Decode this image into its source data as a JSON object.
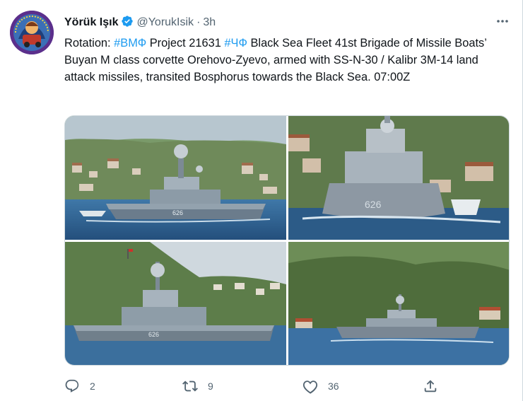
{
  "tweet": {
    "display_name": "Yörük Işık",
    "handle": "@YorukIsik",
    "separator": "·",
    "time": "3h",
    "text_parts": [
      {
        "text": "Rotation: ",
        "type": "text"
      },
      {
        "text": "#ВМФ",
        "type": "hashtag"
      },
      {
        "text": " Project 21631 ",
        "type": "text"
      },
      {
        "text": "#ЧФ",
        "type": "hashtag"
      },
      {
        "text": " Black Sea Fleet 41st Brigade of Missile Boats’ Buyan M class corvette Orehovo-Zyevo, armed with SS-N-30 / Kalibr 3M-14 land attack missiles, transited Bosphorus towards the Black Sea. 07:00Z",
        "type": "text"
      }
    ],
    "media": {
      "photos": [
        {
          "hull_number": "626",
          "scene": "corvette sailing left, side view"
        },
        {
          "hull_number": "626",
          "scene": "corvette bow-on with escort boat"
        },
        {
          "hull_number": "626",
          "scene": "corvette side view, hillside background"
        },
        {
          "hull_number": "",
          "scene": "corvette distant, wooded shore"
        }
      ]
    },
    "actions": {
      "reply_count": "2",
      "retweet_count": "9",
      "like_count": "36"
    },
    "icons": {
      "verified": "verified-badge-icon",
      "more": "more-icon",
      "reply": "reply-icon",
      "retweet": "retweet-icon",
      "like": "like-icon",
      "share": "share-icon"
    },
    "colors": {
      "accent": "#1d9bf0",
      "secondary_text": "#536471",
      "primary_text": "#0f1419",
      "avatar_bg": "#5b2f8c"
    }
  }
}
